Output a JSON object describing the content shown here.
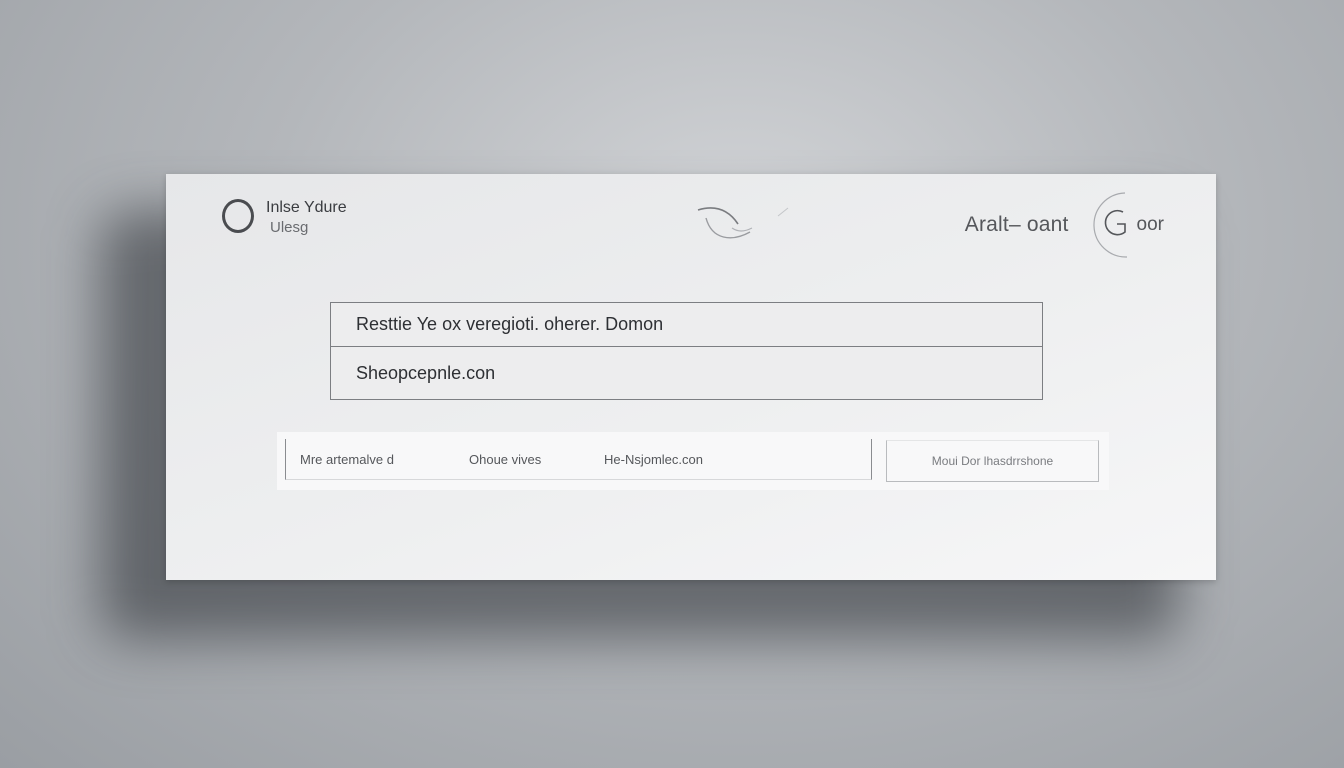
{
  "brand": {
    "title": "Inlse Ydure",
    "subtitle": "Ulesg"
  },
  "header": {
    "link_label": "Aralt– oant",
    "right_label": "oor",
    "logo_icon": "g-circle-icon",
    "swoosh_icon": "swoosh-icon"
  },
  "panel": {
    "row1": "Resttie  Ye ox veregioti. oherer.  Domon",
    "row2": "Sheopcepnle.con"
  },
  "bar": {
    "field1": "Mre artemalve d",
    "field2": "Ohoue vives",
    "field3": "He-Nsjomlec.con",
    "button_label": "Moui Dor  lhasdrrshone"
  },
  "colors": {
    "background": "#b4b7bb",
    "card": "#eeeff0",
    "text_dark": "#2e3034"
  }
}
